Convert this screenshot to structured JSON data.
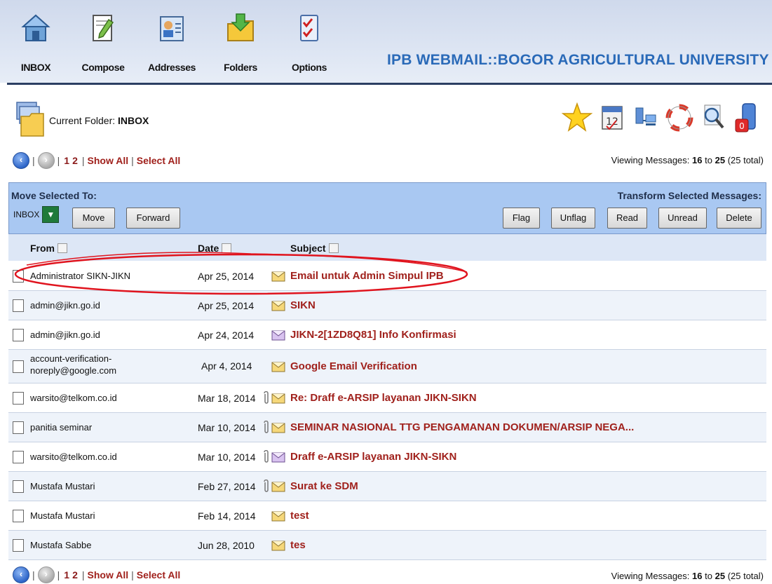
{
  "nav": {
    "items": [
      {
        "label": "INBOX",
        "icon": "house-icon"
      },
      {
        "label": "Compose",
        "icon": "compose-icon"
      },
      {
        "label": "Addresses",
        "icon": "address-book-icon"
      },
      {
        "label": "Folders",
        "icon": "folder-icon"
      },
      {
        "label": "Options",
        "icon": "checklist-icon"
      }
    ],
    "brand": "IPB WEBMAIL::BOGOR AGRICULTURAL UNIVERSITY"
  },
  "folder": {
    "label": "Current Folder:",
    "name": "INBOX"
  },
  "tools": [
    "star-icon",
    "calendar-icon",
    "network-icon",
    "lifebuoy-icon",
    "search-icon",
    "trash-icon"
  ],
  "paging": {
    "pages": [
      "1",
      "2"
    ],
    "show_all": "Show All",
    "select_all": "Select All",
    "viewing_label": "Viewing Messages:",
    "from": "16",
    "to_label": "to",
    "to": "25",
    "total": "(25 total)"
  },
  "actions": {
    "move_label": "Move Selected To:",
    "move_target": "INBOX",
    "move_button": "Move",
    "forward_button": "Forward",
    "transform_label": "Transform Selected Messages:",
    "flag": "Flag",
    "unflag": "Unflag",
    "read": "Read",
    "unread": "Unread",
    "delete": "Delete"
  },
  "columns": {
    "from": "From",
    "date": "Date",
    "subject": "Subject"
  },
  "messages": [
    {
      "from": "Administrator SIKN-JIKN",
      "date": "Apr 25, 2014",
      "subject": "Email untuk Admin Simpul IPB",
      "attachment": false
    },
    {
      "from": "admin@jikn.go.id",
      "date": "Apr 25, 2014",
      "subject": "SIKN",
      "attachment": false
    },
    {
      "from": "admin@jikn.go.id",
      "date": "Apr 24, 2014",
      "subject": "JIKN-2[1ZD8Q81] Info Konfirmasi",
      "attachment": false
    },
    {
      "from": "account-verification-",
      "from2": "noreply@google.com",
      "date": "Apr 4, 2014",
      "subject": "Google Email Verification",
      "attachment": false
    },
    {
      "from": "warsito@telkom.co.id",
      "date": "Mar 18, 2014",
      "subject": "Re: Draff e-ARSIP layanan JIKN-SIKN",
      "attachment": true
    },
    {
      "from": "panitia seminar",
      "date": "Mar 10, 2014",
      "subject": "SEMINAR NASIONAL TTG PENGAMANAN DOKUMEN/ARSIP NEGA...",
      "attachment": true
    },
    {
      "from": "warsito@telkom.co.id",
      "date": "Mar 10, 2014",
      "subject": "Draff e-ARSIP layanan JIKN-SIKN",
      "attachment": true
    },
    {
      "from": "Mustafa Mustari",
      "date": "Feb 27, 2014",
      "subject": "Surat ke SDM",
      "attachment": true
    },
    {
      "from": "Mustafa Mustari",
      "date": "Feb 14, 2014",
      "subject": "test",
      "attachment": false
    },
    {
      "from": "Mustafa Sabbe",
      "date": "Jun 28, 2010",
      "subject": "tes",
      "attachment": false
    }
  ],
  "colors": {
    "accent": "#a0211c",
    "brand": "#2a6ab8",
    "bar": "#a9c8f2",
    "highlight": "#e0141e"
  }
}
